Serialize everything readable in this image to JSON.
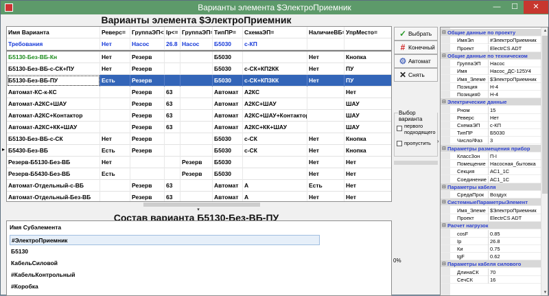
{
  "window": {
    "title": "Варианты элемента $ЭлектроПриемник",
    "min_icon": "—",
    "max_icon": "☐",
    "close_icon": "✕"
  },
  "variants": {
    "title": "Варианты элемента $ЭлектроПриемник",
    "columns": [
      "Имя Варианта",
      "Реверс=",
      "ГруппаЭП<>",
      "Iр<=",
      "ГруппаЭП=",
      "ТипПР=",
      "СхемаЭП=",
      "НаличиеВБ=",
      "УпрМесто="
    ],
    "requirements": [
      "Требования",
      "Нет",
      "Насос",
      "26.8",
      "Насос",
      "Б5030",
      "с-КП",
      "",
      ""
    ],
    "rows": [
      [
        "Б5130-Без-ВБ-Кн",
        "Нет",
        "Резерв",
        "",
        "",
        "Б5030",
        "",
        "Нет",
        "Кнопка"
      ],
      [
        "Б5130-Без-ВБ-с-СК+ПУ",
        "Нет",
        "Резерв",
        "",
        "",
        "Б5030",
        "с-СК+КП2КК",
        "Нет",
        "ПУ"
      ],
      [
        "Б5130-Без-ВБ-ПУ",
        "Есть",
        "Резерв",
        "",
        "",
        "Б5030",
        "с-СК+КП3КК",
        "Нет",
        "ПУ"
      ],
      [
        "Автомат-КС-к-КС",
        "",
        "Резерв",
        "63",
        "",
        "Автомат",
        "А2КС",
        "",
        "Нет"
      ],
      [
        "Автомат-А2КС+ШАУ",
        "",
        "Резерв",
        "63",
        "",
        "Автомат",
        "А2КС+ШАУ",
        "",
        "ШАУ"
      ],
      [
        "Автомат-А2КС+Контактор",
        "",
        "Резерв",
        "63",
        "",
        "Автомат",
        "А2КС+ШАУ+Контактор",
        "",
        "ШАУ"
      ],
      [
        "Автомат-А2КС+КК+ШАУ",
        "",
        "Резерв",
        "63",
        "",
        "Автомат",
        "А2КС+КК+ШАУ",
        "",
        "ШАУ"
      ],
      [
        "Б5130-Без-ВБ-с-СК",
        "Нет",
        "Резерв",
        "",
        "",
        "Б5030",
        "с-СК",
        "Нет",
        "Кнопка"
      ],
      [
        "Б5430-Без-ВБ",
        "Есть",
        "Резерв",
        "",
        "",
        "Б5030",
        "с-СК",
        "Нет",
        "Кнопка"
      ],
      [
        "Резерв-Б5130-Без-ВБ",
        "Нет",
        "",
        "",
        "Резерв",
        "Б5030",
        "",
        "Нет",
        "Нет"
      ],
      [
        "Резерв-Б5430-Без-ВБ",
        "Есть",
        "",
        "",
        "Резерв",
        "Б5030",
        "",
        "Нет",
        "Нет"
      ],
      [
        "Автомат-Отдельный-с-ВБ",
        "",
        "Резерв",
        "63",
        "",
        "Автомат",
        "А",
        "Есть",
        "Нет"
      ],
      [
        "Автомат-Отдельный-Без-ВБ",
        "",
        "Резерв",
        "63",
        "",
        "Автомат",
        "А",
        "Нет",
        "Нет"
      ],
      [
        "Автомат-Резерв",
        "",
        "Резерв",
        "63",
        "",
        "Автомат",
        "АР",
        "",
        "Нет"
      ]
    ]
  },
  "actions": {
    "select": "Выбрать",
    "final": "Конечный",
    "auto": "Автомат",
    "remove": "Снять",
    "select_group": "Выбор варианта",
    "opt_first": "первого подходящего",
    "opt_skip": "пропустить",
    "percent": "0%"
  },
  "composition": {
    "title": "Состав варианта Б5130-Без-ВБ-ПУ",
    "header": "Имя Субэлемента",
    "items": [
      "#ЭлектроПриемник",
      "Б5130",
      "КабельСиловой",
      "#КабельКонтрольный",
      "#Коробка"
    ]
  },
  "properties": [
    {
      "category": "Общие данные по проекту",
      "items": [
        [
          "ИмяЭл",
          "#ЭлектроПриемник"
        ],
        [
          "Проект",
          "ElectrCS ADT"
        ]
      ]
    },
    {
      "category": "Общие данные по техническом",
      "items": [
        [
          "ГруппаЭП",
          "Насос"
        ],
        [
          "Имя",
          "Насос_ДС-125У4"
        ],
        [
          "Имя_Элеме",
          "$ЭлектроПриемник"
        ],
        [
          "Позиция",
          "Н-4"
        ],
        [
          "Позиция0",
          "Н-4"
        ]
      ]
    },
    {
      "category": "Электрические данные",
      "items": [
        [
          "Рном",
          "15"
        ],
        [
          "Реверс",
          "Нет"
        ],
        [
          "СхемаЭП",
          "с-КП"
        ],
        [
          "ТипПР",
          "Б5030"
        ],
        [
          "Число/Фаз",
          "3"
        ]
      ]
    },
    {
      "category": "Параметры размещения прибор",
      "items": [
        [
          "КлассЗон",
          "П-I"
        ],
        [
          "Помещение",
          "Насосная_бытовка"
        ],
        [
          "Секция",
          "АС1_1С"
        ],
        [
          "Соединение",
          "АС1_1С"
        ]
      ]
    },
    {
      "category": "Параметры кабеля",
      "items": [
        [
          "СредаПрок",
          "Воздух"
        ]
      ]
    },
    {
      "category": "СистемныеПараметрыЭлемент",
      "items": [
        [
          "Имя_Элеме",
          "$ЭлектроПриемник"
        ],
        [
          "Проект",
          "ElectrCS ADT"
        ]
      ]
    },
    {
      "category": "Расчет нагрузок",
      "items": [
        [
          "cosF",
          "0.85"
        ],
        [
          "Ip",
          "26.8"
        ],
        [
          "Ки",
          "0.75"
        ],
        [
          "tgF",
          "0.62"
        ]
      ]
    },
    {
      "category": "Параметры кабеля силового",
      "items": [
        [
          "ДлинаСК",
          "70"
        ],
        [
          "СечСК",
          "16"
        ]
      ]
    }
  ]
}
